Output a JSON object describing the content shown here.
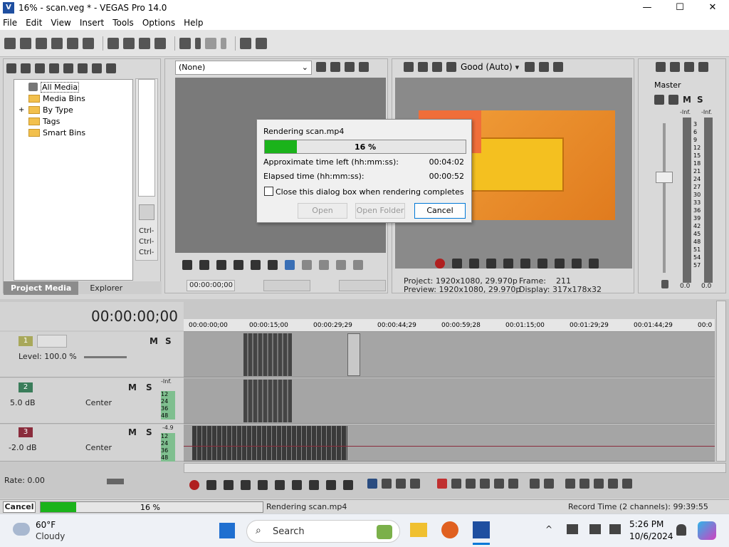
{
  "window": {
    "title": "16% - scan.veg * - VEGAS Pro 14.0",
    "controls": {
      "minimize": "—",
      "maximize": "☐",
      "close": "✕"
    }
  },
  "menu": [
    "File",
    "Edit",
    "View",
    "Insert",
    "Tools",
    "Options",
    "Help"
  ],
  "project_media": {
    "tree": [
      "All Media",
      "Media Bins",
      "By Type",
      "Tags",
      "Smart Bins"
    ],
    "expand_glyph": "+",
    "tabs": [
      "Project Media",
      "Explorer"
    ],
    "side_labels": [
      "Ctrl-",
      "Ctrl-",
      "Ctrl-"
    ]
  },
  "trimmer": {
    "selector": "(None)",
    "timecode": "00:00:00;00"
  },
  "preview": {
    "quality": "Good (Auto)",
    "project_label": "Project:",
    "project_value": "1920x1080, 29.970p",
    "preview_label": "Preview:",
    "preview_value": "1920x1080, 29.970p",
    "frame_label": "Frame:",
    "frame_value": "211",
    "display_label": "Display:",
    "display_value": "317x178x32"
  },
  "master": {
    "title": "Master",
    "ms": [
      "M",
      "S"
    ],
    "inf_left": "-Inf.",
    "inf_right": "-Inf.",
    "scale": [
      "3",
      "6",
      "9",
      "12",
      "15",
      "18",
      "21",
      "24",
      "27",
      "30",
      "33",
      "36",
      "39",
      "42",
      "45",
      "48",
      "51",
      "54",
      "57"
    ],
    "foot_left": "0.0",
    "foot_right": "0.0"
  },
  "render_dialog": {
    "title": "Rendering scan.mp4",
    "progress_text": "16 %",
    "progress_fraction": 0.16,
    "time_left_label": "Approximate time left (hh:mm:ss):",
    "time_left_value": "00:04:02",
    "elapsed_label": "Elapsed time (hh:mm:ss):",
    "elapsed_value": "00:00:52",
    "close_checkbox": "Close this dialog box when rendering completes",
    "open": "Open",
    "open_folder": "Open Folder",
    "cancel": "Cancel"
  },
  "timeline": {
    "timecode": "00:00:00;00",
    "ruler": [
      "00:00:00;00",
      "00:00:15;00",
      "00:00:29;29",
      "00:00:44;29",
      "00:00:59;28",
      "00:01:15;00",
      "00:01:29;29",
      "00:01:44;29",
      "00:0"
    ],
    "tracks": [
      {
        "num": "1",
        "level": "Level: 100.0 %",
        "m": "M",
        "s": "S"
      },
      {
        "num": "2",
        "db": "5.0 dB",
        "pan": "Center",
        "m": "M",
        "s": "S",
        "meter_top": "-Inf.",
        "meter": [
          "12",
          "24",
          "36",
          "48"
        ]
      },
      {
        "num": "3",
        "db": "-2.0 dB",
        "pan": "Center",
        "m": "M",
        "s": "S",
        "meter_top": "-4.9",
        "meter": [
          "12",
          "24",
          "36",
          "48"
        ]
      }
    ],
    "rate": "Rate: 0.00"
  },
  "status": {
    "cancel": "Cancel",
    "progress_text": "16 %",
    "progress_fraction": 0.16,
    "message": "Rendering scan.mp4",
    "record_time": "Record Time (2 channels): 99:39:55"
  },
  "taskbar": {
    "weather_temp": "60°F",
    "weather_desc": "Cloudy",
    "search": "Search",
    "time": "5:26 PM",
    "date": "10/6/2024"
  },
  "colors": {
    "progress": "#1bb31b",
    "accent": "#0078d7",
    "track1": "#a8a85a",
    "track2": "#3a7d5a",
    "track3": "#8a2c3c"
  }
}
